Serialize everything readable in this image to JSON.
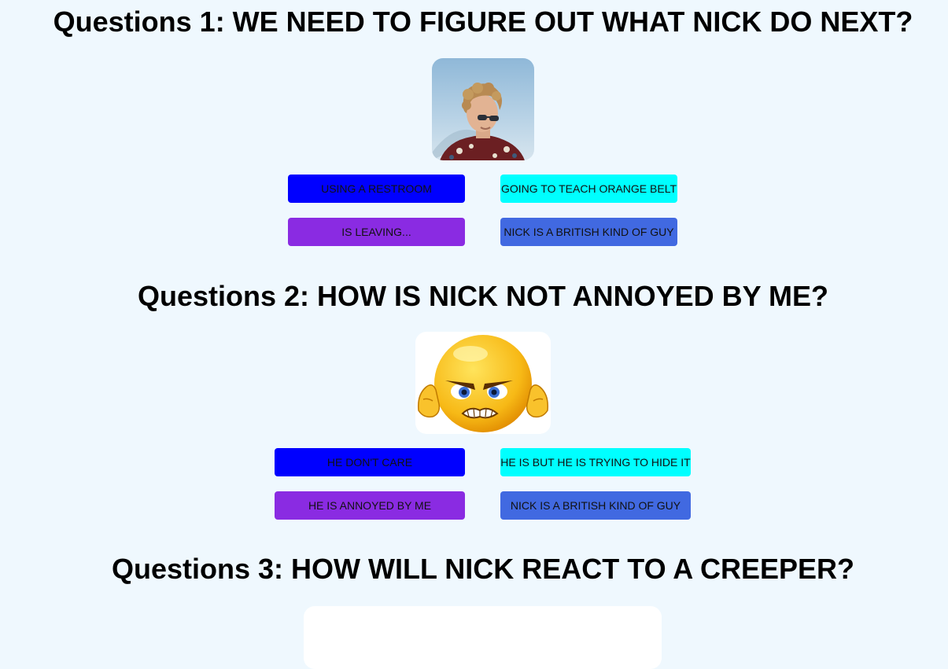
{
  "questions": [
    {
      "title": "Questions 1: WE NEED TO FIGURE OUT WHAT NICK DO NEXT?",
      "image": "nick-portrait-photo",
      "answers": [
        "USING A RESTROOM",
        "GOING TO TEACH ORANGE BELT",
        "IS LEAVING...",
        "NICK IS A BRITISH KIND OF GUY"
      ]
    },
    {
      "title": "Questions 2: HOW IS NICK NOT ANNOYED BY ME?",
      "image": "angry-emoji-covering-ears",
      "answers": [
        "HE DON'T CARE",
        "HE IS BUT HE IS TRYING TO HIDE IT",
        "HE IS ANNOYED BY ME",
        "NICK IS A BRITISH KIND OF GUY"
      ]
    },
    {
      "title": "Questions 3: HOW WILL NICK REACT TO A CREEPER?",
      "image": "",
      "answers": []
    }
  ],
  "colors": {
    "background": "#eff8fe",
    "answer_1": "#0000ff",
    "answer_2": "#00ffff",
    "answer_3": "#8a2be2",
    "answer_4": "#4169e1"
  }
}
